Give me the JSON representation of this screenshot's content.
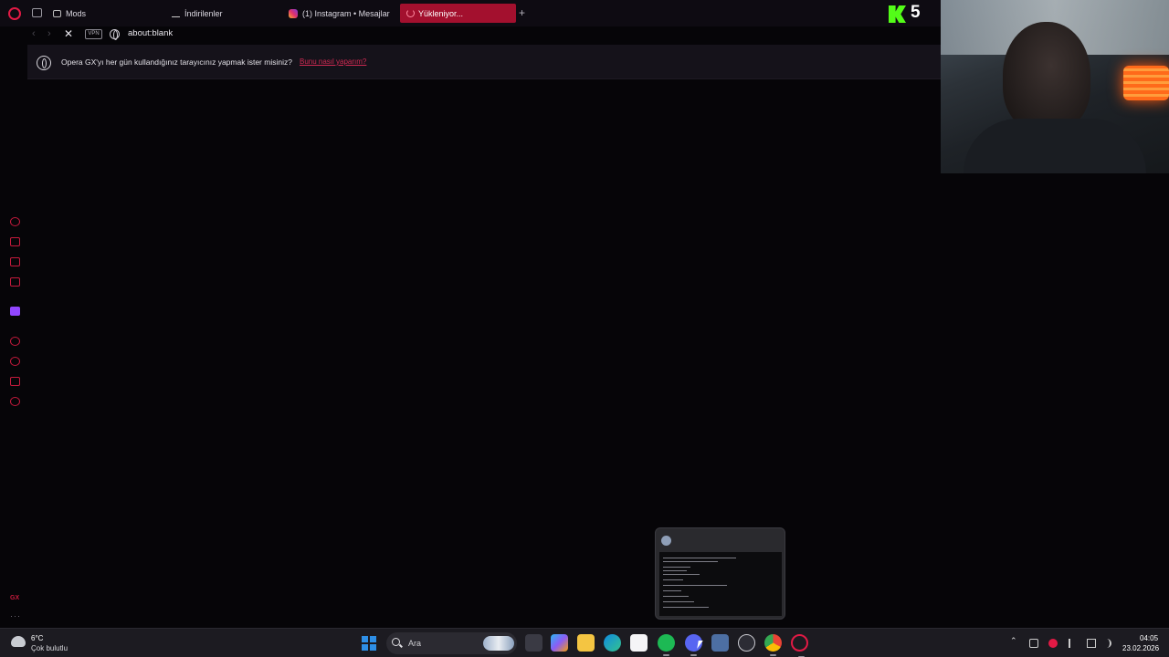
{
  "tabs": {
    "mods": "Mods",
    "downloads": "İndirilenler",
    "instagram": "(1) Instagram • Mesajlar",
    "loading": "Yükleniyor..."
  },
  "address": {
    "vpn_label": "VPN",
    "url": "about:blank"
  },
  "banner": {
    "text": "Opera GX'yı her gün kullandığınız tarayıcınız yapmak ister misiniz?",
    "link": "Bunu nasıl yaparım?"
  },
  "sidebar": {
    "gx_label": "GX",
    "more": "···"
  },
  "overlay": {
    "kick_viewers": "5",
    "kick_color": "#53fc18"
  },
  "taskbar": {
    "temperature": "6°C",
    "weather": "Çok bulutlu",
    "search_label": "Ara",
    "time": "04:05",
    "date": "23.02.2026"
  },
  "colors": {
    "accent": "#e21a45",
    "active_tab": "#a3102e",
    "banner_link": "#d12a53"
  },
  "icons": [
    "opera-logo",
    "close-tab-icon",
    "plus-icon",
    "back-icon",
    "forward-icon",
    "stop-icon",
    "globe-icon",
    "info-icon",
    "windows-icon",
    "search-icon"
  ]
}
